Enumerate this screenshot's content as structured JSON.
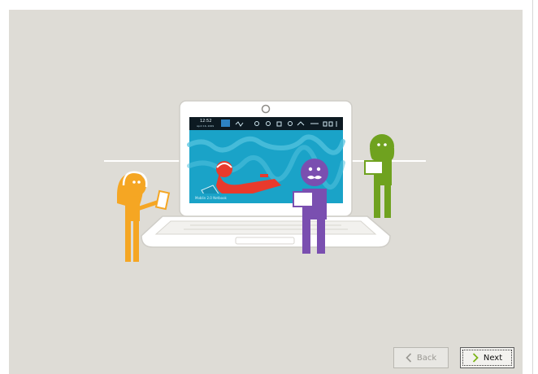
{
  "wizard": {
    "back_label": "Back",
    "next_label": "Next",
    "back_enabled": false
  },
  "screen": {
    "clock": "12:52",
    "date": "April 16, 2009",
    "caption": "Moblin 2.0 Netbook"
  },
  "icons": {
    "back": "chevron-left-icon",
    "next": "chevron-right-icon"
  },
  "colors": {
    "background": "#dedcd6",
    "laptop_screen": "#1aa3c8",
    "person_orange": "#f5a623",
    "person_purple": "#7a4fb0",
    "person_green": "#6fa21f",
    "figure_red": "#e83a2c",
    "next_accent": "#7cb518"
  }
}
